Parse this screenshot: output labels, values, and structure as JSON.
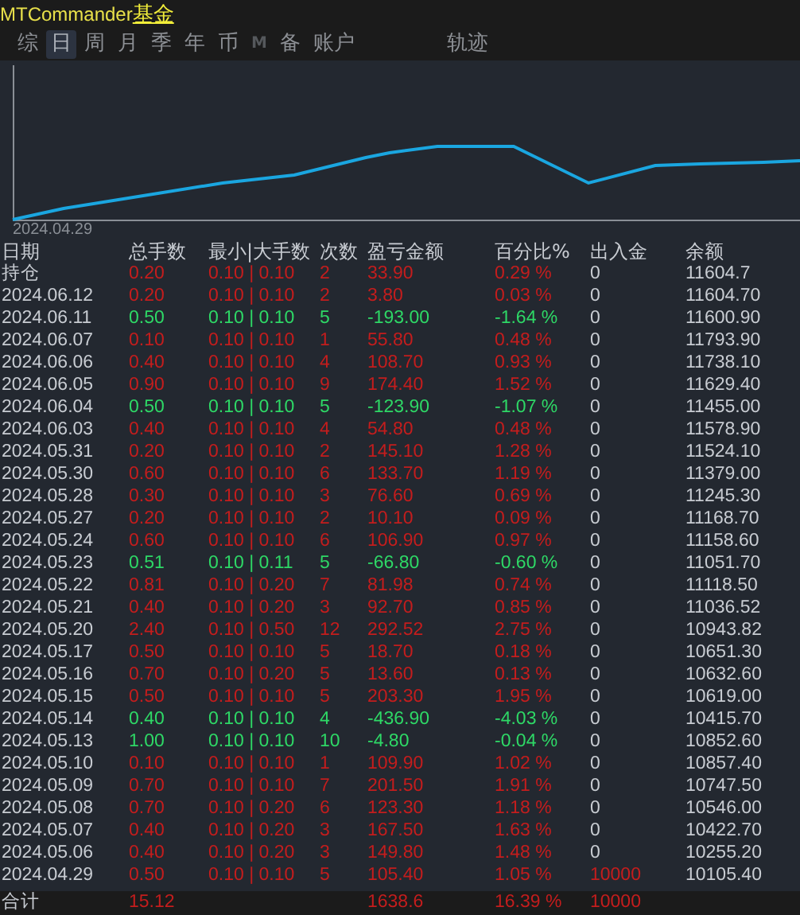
{
  "header": {
    "app_name": "MTCommander",
    "link": "基金"
  },
  "tabs": [
    {
      "label": "综",
      "selected": false,
      "disabled": false
    },
    {
      "label": "日",
      "selected": true,
      "disabled": false
    },
    {
      "label": "周",
      "selected": false,
      "disabled": false
    },
    {
      "label": "月",
      "selected": false,
      "disabled": false
    },
    {
      "label": "季",
      "selected": false,
      "disabled": false
    },
    {
      "label": "年",
      "selected": false,
      "disabled": false
    },
    {
      "label": "币",
      "selected": false,
      "disabled": false
    },
    {
      "label": "M",
      "selected": false,
      "disabled": true
    },
    {
      "label": "备",
      "selected": false,
      "disabled": false
    },
    {
      "label": "账户",
      "selected": false,
      "disabled": false
    },
    {
      "label": "轨迹",
      "selected": false,
      "disabled": false
    }
  ],
  "chart": {
    "start_label": "2024.04.29"
  },
  "table": {
    "columns": [
      "日期",
      "总手数",
      "最小|大手数",
      "次数",
      "盈亏金额",
      "百分比%",
      "出入金",
      "余额"
    ],
    "rows": [
      {
        "date": "持仓",
        "lots": "0.20",
        "minmax": "0.10 | 0.10",
        "count": "2",
        "pnl": "33.90",
        "pct": "0.29 %",
        "deposit": "0",
        "balance": "11604.7",
        "kind": "gain",
        "deposit_marked": false
      },
      {
        "date": "2024.06.12",
        "lots": "0.20",
        "minmax": "0.10 | 0.10",
        "count": "2",
        "pnl": "3.80",
        "pct": "0.03 %",
        "deposit": "0",
        "balance": "11604.70",
        "kind": "gain",
        "deposit_marked": false
      },
      {
        "date": "2024.06.11",
        "lots": "0.50",
        "minmax": "0.10 | 0.10",
        "count": "5",
        "pnl": "-193.00",
        "pct": "-1.64 %",
        "deposit": "0",
        "balance": "11600.90",
        "kind": "loss",
        "deposit_marked": false
      },
      {
        "date": "2024.06.07",
        "lots": "0.10",
        "minmax": "0.10 | 0.10",
        "count": "1",
        "pnl": "55.80",
        "pct": "0.48 %",
        "deposit": "0",
        "balance": "11793.90",
        "kind": "gain",
        "deposit_marked": false
      },
      {
        "date": "2024.06.06",
        "lots": "0.40",
        "minmax": "0.10 | 0.10",
        "count": "4",
        "pnl": "108.70",
        "pct": "0.93 %",
        "deposit": "0",
        "balance": "11738.10",
        "kind": "gain",
        "deposit_marked": false
      },
      {
        "date": "2024.06.05",
        "lots": "0.90",
        "minmax": "0.10 | 0.10",
        "count": "9",
        "pnl": "174.40",
        "pct": "1.52 %",
        "deposit": "0",
        "balance": "11629.40",
        "kind": "gain",
        "deposit_marked": false
      },
      {
        "date": "2024.06.04",
        "lots": "0.50",
        "minmax": "0.10 | 0.10",
        "count": "5",
        "pnl": "-123.90",
        "pct": "-1.07 %",
        "deposit": "0",
        "balance": "11455.00",
        "kind": "loss",
        "deposit_marked": false
      },
      {
        "date": "2024.06.03",
        "lots": "0.40",
        "minmax": "0.10 | 0.10",
        "count": "4",
        "pnl": "54.80",
        "pct": "0.48 %",
        "deposit": "0",
        "balance": "11578.90",
        "kind": "gain",
        "deposit_marked": false
      },
      {
        "date": "2024.05.31",
        "lots": "0.20",
        "minmax": "0.10 | 0.10",
        "count": "2",
        "pnl": "145.10",
        "pct": "1.28 %",
        "deposit": "0",
        "balance": "11524.10",
        "kind": "gain",
        "deposit_marked": false
      },
      {
        "date": "2024.05.30",
        "lots": "0.60",
        "minmax": "0.10 | 0.10",
        "count": "6",
        "pnl": "133.70",
        "pct": "1.19 %",
        "deposit": "0",
        "balance": "11379.00",
        "kind": "gain",
        "deposit_marked": false
      },
      {
        "date": "2024.05.28",
        "lots": "0.30",
        "minmax": "0.10 | 0.10",
        "count": "3",
        "pnl": "76.60",
        "pct": "0.69 %",
        "deposit": "0",
        "balance": "11245.30",
        "kind": "gain",
        "deposit_marked": false
      },
      {
        "date": "2024.05.27",
        "lots": "0.20",
        "minmax": "0.10 | 0.10",
        "count": "2",
        "pnl": "10.10",
        "pct": "0.09 %",
        "deposit": "0",
        "balance": "11168.70",
        "kind": "gain",
        "deposit_marked": false
      },
      {
        "date": "2024.05.24",
        "lots": "0.60",
        "minmax": "0.10 | 0.10",
        "count": "6",
        "pnl": "106.90",
        "pct": "0.97 %",
        "deposit": "0",
        "balance": "11158.60",
        "kind": "gain",
        "deposit_marked": false
      },
      {
        "date": "2024.05.23",
        "lots": "0.51",
        "minmax": "0.10 | 0.11",
        "count": "5",
        "pnl": "-66.80",
        "pct": "-0.60 %",
        "deposit": "0",
        "balance": "11051.70",
        "kind": "loss",
        "deposit_marked": false
      },
      {
        "date": "2024.05.22",
        "lots": "0.81",
        "minmax": "0.10 | 0.20",
        "count": "7",
        "pnl": "81.98",
        "pct": "0.74 %",
        "deposit": "0",
        "balance": "11118.50",
        "kind": "gain",
        "deposit_marked": false
      },
      {
        "date": "2024.05.21",
        "lots": "0.40",
        "minmax": "0.10 | 0.20",
        "count": "3",
        "pnl": "92.70",
        "pct": "0.85 %",
        "deposit": "0",
        "balance": "11036.52",
        "kind": "gain",
        "deposit_marked": false
      },
      {
        "date": "2024.05.20",
        "lots": "2.40",
        "minmax": "0.10 | 0.50",
        "count": "12",
        "pnl": "292.52",
        "pct": "2.75 %",
        "deposit": "0",
        "balance": "10943.82",
        "kind": "gain",
        "deposit_marked": false
      },
      {
        "date": "2024.05.17",
        "lots": "0.50",
        "minmax": "0.10 | 0.10",
        "count": "5",
        "pnl": "18.70",
        "pct": "0.18 %",
        "deposit": "0",
        "balance": "10651.30",
        "kind": "gain",
        "deposit_marked": false
      },
      {
        "date": "2024.05.16",
        "lots": "0.70",
        "minmax": "0.10 | 0.20",
        "count": "5",
        "pnl": "13.60",
        "pct": "0.13 %",
        "deposit": "0",
        "balance": "10632.60",
        "kind": "gain",
        "deposit_marked": false
      },
      {
        "date": "2024.05.15",
        "lots": "0.50",
        "minmax": "0.10 | 0.10",
        "count": "5",
        "pnl": "203.30",
        "pct": "1.95 %",
        "deposit": "0",
        "balance": "10619.00",
        "kind": "gain",
        "deposit_marked": false
      },
      {
        "date": "2024.05.14",
        "lots": "0.40",
        "minmax": "0.10 | 0.10",
        "count": "4",
        "pnl": "-436.90",
        "pct": "-4.03 %",
        "deposit": "0",
        "balance": "10415.70",
        "kind": "loss",
        "deposit_marked": false
      },
      {
        "date": "2024.05.13",
        "lots": "1.00",
        "minmax": "0.10 | 0.10",
        "count": "10",
        "pnl": "-4.80",
        "pct": "-0.04 %",
        "deposit": "0",
        "balance": "10852.60",
        "kind": "loss",
        "deposit_marked": false
      },
      {
        "date": "2024.05.10",
        "lots": "0.10",
        "minmax": "0.10 | 0.10",
        "count": "1",
        "pnl": "109.90",
        "pct": "1.02 %",
        "deposit": "0",
        "balance": "10857.40",
        "kind": "gain",
        "deposit_marked": false
      },
      {
        "date": "2024.05.09",
        "lots": "0.70",
        "minmax": "0.10 | 0.10",
        "count": "7",
        "pnl": "201.50",
        "pct": "1.91 %",
        "deposit": "0",
        "balance": "10747.50",
        "kind": "gain",
        "deposit_marked": false
      },
      {
        "date": "2024.05.08",
        "lots": "0.70",
        "minmax": "0.10 | 0.20",
        "count": "6",
        "pnl": "123.30",
        "pct": "1.18 %",
        "deposit": "0",
        "balance": "10546.00",
        "kind": "gain",
        "deposit_marked": false
      },
      {
        "date": "2024.05.07",
        "lots": "0.40",
        "minmax": "0.10 | 0.20",
        "count": "3",
        "pnl": "167.50",
        "pct": "1.63 %",
        "deposit": "0",
        "balance": "10422.70",
        "kind": "gain",
        "deposit_marked": false
      },
      {
        "date": "2024.05.06",
        "lots": "0.40",
        "minmax": "0.10 | 0.20",
        "count": "3",
        "pnl": "149.80",
        "pct": "1.48 %",
        "deposit": "0",
        "balance": "10255.20",
        "kind": "gain",
        "deposit_marked": false
      },
      {
        "date": "2024.04.29",
        "lots": "0.50",
        "minmax": "0.10 | 0.10",
        "count": "5",
        "pnl": "105.40",
        "pct": "1.05 %",
        "deposit": "10000",
        "balance": "10105.40",
        "kind": "gain",
        "deposit_marked": true
      }
    ],
    "total": {
      "label": "合计",
      "lots": "15.12",
      "pnl": "1638.6",
      "pct": "16.39 %",
      "deposit": "10000"
    }
  }
}
